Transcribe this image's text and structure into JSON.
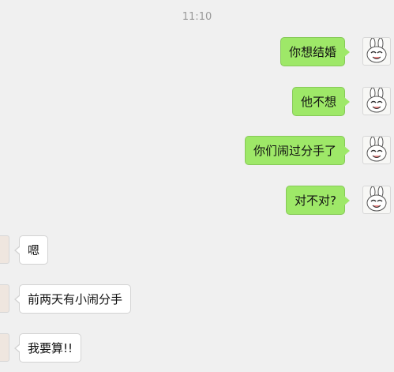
{
  "timestamp": "11:10",
  "messages": [
    {
      "sender": "me",
      "text": "你想结婚"
    },
    {
      "sender": "me",
      "text": "他不想"
    },
    {
      "sender": "me",
      "text": "你们闹过分手了"
    },
    {
      "sender": "me",
      "text": "对不对?"
    },
    {
      "sender": "other",
      "text": "嗯"
    },
    {
      "sender": "other",
      "text": "前两天有小闹分手"
    },
    {
      "sender": "other",
      "text": "我要算!!"
    }
  ],
  "avatars": {
    "me": "cartoon-rabbit-avatar",
    "other": "contact-avatar"
  },
  "colors": {
    "me_bubble": "#9ee868",
    "other_bubble": "#ffffff",
    "background": "#f0f0f0"
  }
}
